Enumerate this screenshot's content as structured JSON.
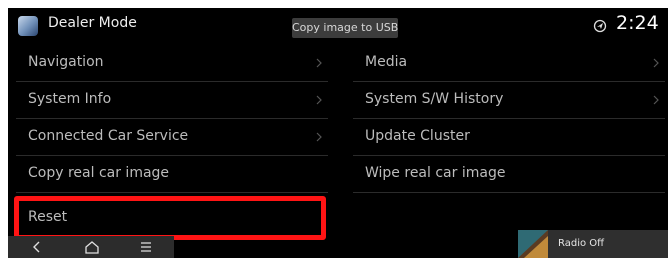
{
  "header": {
    "title": "Dealer Mode",
    "copy_button": "Copy image to USB",
    "clock": "2:24",
    "app_icon": "dealer-mode-icon",
    "status_icon": "gps-icon"
  },
  "menu": {
    "left": [
      {
        "label": "Navigation",
        "has_arrow": true
      },
      {
        "label": "System Info",
        "has_arrow": true
      },
      {
        "label": "Connected Car Service",
        "has_arrow": true
      },
      {
        "label": "Copy real car image",
        "has_arrow": false
      },
      {
        "label": "Reset",
        "has_arrow": false
      }
    ],
    "right": [
      {
        "label": "Media",
        "has_arrow": true
      },
      {
        "label": "System S/W History",
        "has_arrow": true
      },
      {
        "label": "Update Cluster",
        "has_arrow": false
      },
      {
        "label": "Wipe real car image",
        "has_arrow": false
      }
    ]
  },
  "highlight": {
    "color": "#ff1414",
    "target": "Reset"
  },
  "navbar": {
    "icons": [
      "back-icon",
      "home-icon",
      "menu-icon"
    ]
  },
  "radio": {
    "label": "Radio Off"
  }
}
